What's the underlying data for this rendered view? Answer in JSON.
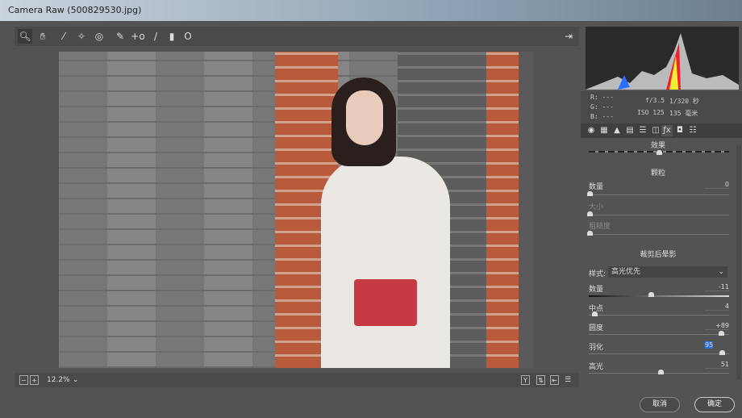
{
  "window": {
    "title": "Camera Raw (500829530.jpg)"
  },
  "toolbar": {
    "tools": [
      "zoom-icon",
      "hand-icon",
      "white-balance-icon",
      "color-sampler-icon",
      "target-adjust-icon",
      "spot-removal-icon",
      "red-eye-icon",
      "adjustment-brush-icon",
      "graduated-filter-icon",
      "radial-filter-icon"
    ]
  },
  "bottom": {
    "zoom": "12.2%",
    "minus": "−",
    "plus": "+",
    "y_label": "Y"
  },
  "info": {
    "r": "R:  ---",
    "g": "G:  ---",
    "b": "B:  ---",
    "aperture": "f/3.5",
    "shutter": "1/320 秒",
    "iso": "ISO 125",
    "focal": "135 毫米"
  },
  "panel": {
    "title": "效果",
    "grain": {
      "title": "颗粒",
      "amount_label": "数量",
      "amount": "0",
      "size_label": "大小",
      "roughness_label": "粗糙度"
    },
    "vignette": {
      "title": "裁剪后晕影",
      "style_label": "样式:",
      "style_value": "高光优先",
      "sliders": [
        {
          "label": "数量",
          "value": "-11",
          "pos": -11,
          "min": -100,
          "max": 100
        },
        {
          "label": "中点",
          "value": "4",
          "pos": 4,
          "min": 0,
          "max": 100
        },
        {
          "label": "圆度",
          "value": "+89",
          "pos": 89,
          "min": -100,
          "max": 100
        },
        {
          "label": "羽化",
          "value": "95",
          "pos": 95,
          "min": 0,
          "max": 100
        },
        {
          "label": "高光",
          "value": "51",
          "pos": 51,
          "min": 0,
          "max": 100
        }
      ]
    }
  },
  "buttons": {
    "cancel": "取消",
    "ok": "确定"
  }
}
